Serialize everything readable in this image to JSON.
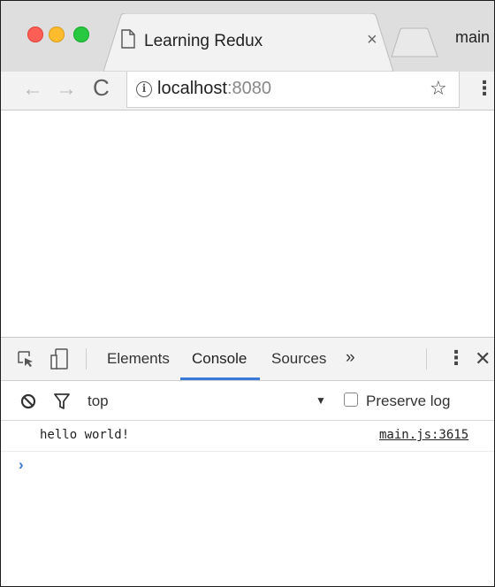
{
  "browser": {
    "tab": {
      "title": "Learning Redux",
      "close": "×"
    },
    "profile_label": "main",
    "toolbar": {
      "back": "←",
      "forward": "→",
      "reload": "C",
      "url_host": "localhost",
      "url_port": ":8080",
      "bookmark": "☆",
      "menu": "⋮"
    }
  },
  "devtools": {
    "tabs": [
      "Elements",
      "Console",
      "Sources"
    ],
    "active_tab": "Console",
    "more_tabs": "»",
    "menu": "⋮",
    "close": "✕",
    "context": "top",
    "context_arrow": "▼",
    "preserve_log": {
      "label": "Preserve log",
      "checked": false
    },
    "console": {
      "messages": [
        {
          "text": "hello world!",
          "source": "main.js:3615"
        }
      ],
      "prompt": "›"
    }
  },
  "colors": {
    "accent": "#3879d9",
    "close": "#fd5e56",
    "minimize": "#fdbb2e",
    "maximize": "#28c840"
  }
}
